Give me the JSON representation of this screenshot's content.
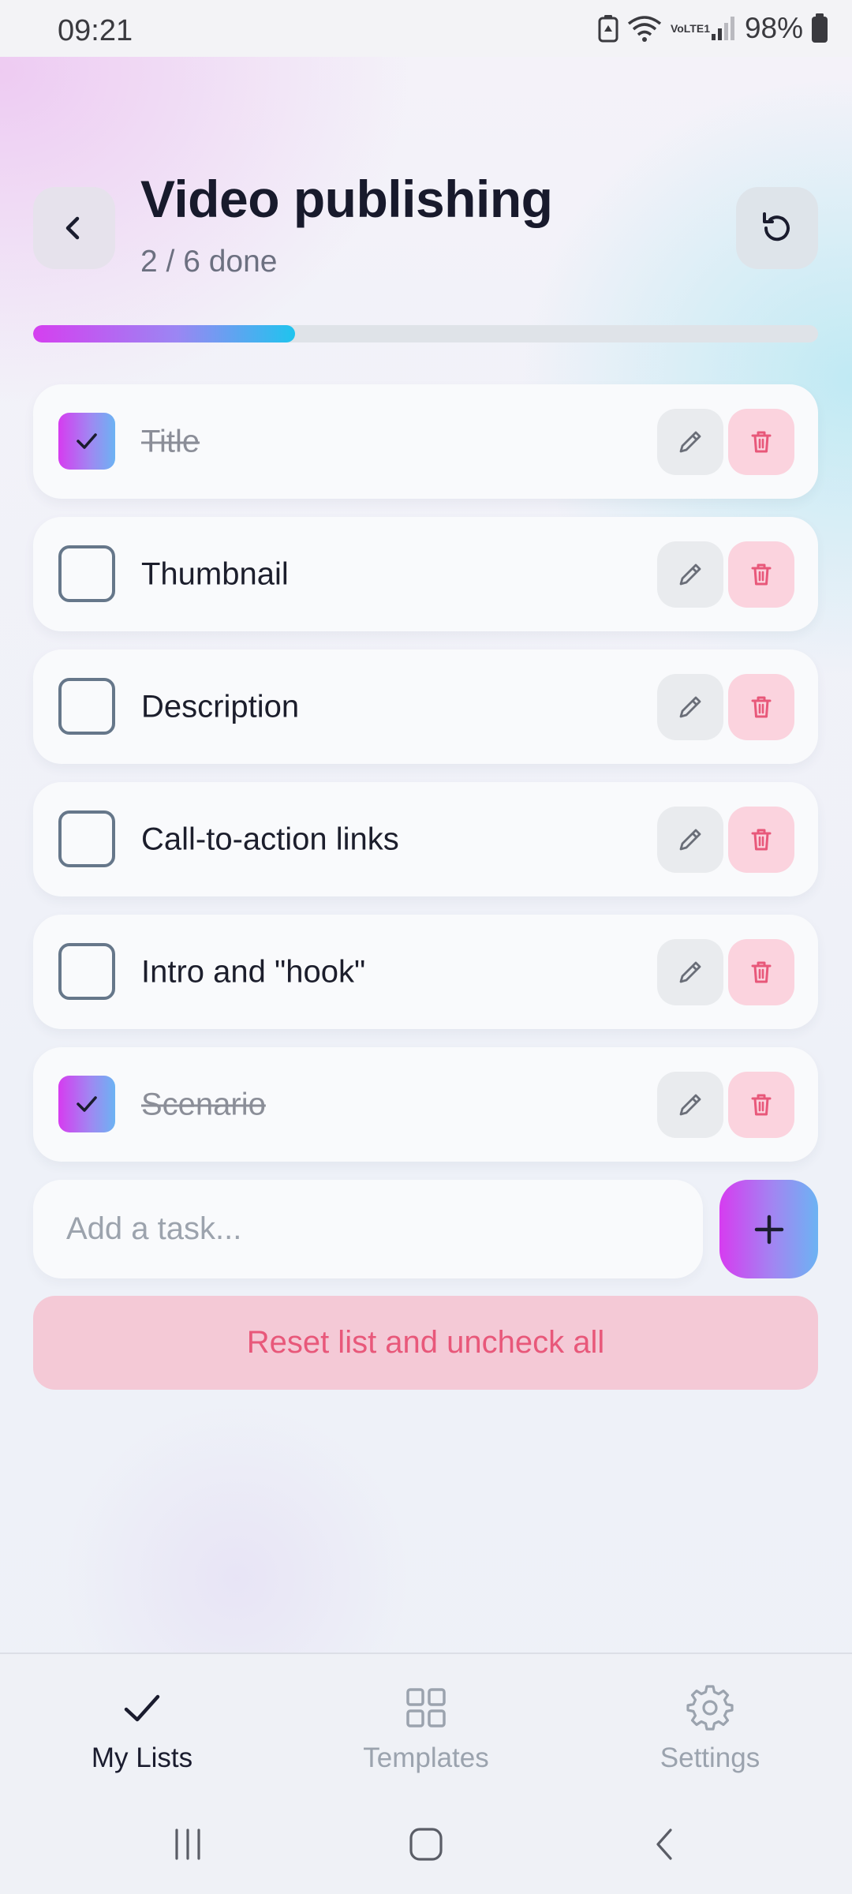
{
  "status_bar": {
    "time": "09:21",
    "signal_label": "VoLTE1",
    "battery_percent": "98%"
  },
  "header": {
    "title": "Video publishing",
    "progress_text": "2 / 6 done",
    "progress_fraction": 0.3333,
    "back_icon": "chevron-left-icon",
    "reset_icon": "refresh-icon"
  },
  "tasks": [
    {
      "label": "Title",
      "checked": true
    },
    {
      "label": "Thumbnail",
      "checked": false
    },
    {
      "label": "Description",
      "checked": false
    },
    {
      "label": "Call-to-action links",
      "checked": false
    },
    {
      "label": "Intro and \"hook\"",
      "checked": false
    },
    {
      "label": "Scenario",
      "checked": true
    }
  ],
  "add_task": {
    "placeholder": "Add a task..."
  },
  "reset_all_label": "Reset list and uncheck all",
  "bottom_nav": {
    "items": [
      {
        "label": "My Lists",
        "icon": "check-icon",
        "active": true
      },
      {
        "label": "Templates",
        "icon": "grid-icon",
        "active": false
      },
      {
        "label": "Settings",
        "icon": "gear-icon",
        "active": false
      }
    ]
  },
  "colors": {
    "accent_gradient_start": "#d63cf0",
    "accent_gradient_end": "#1fc4ee",
    "danger": "#e8587a",
    "danger_bg": "#f4c9d6"
  }
}
